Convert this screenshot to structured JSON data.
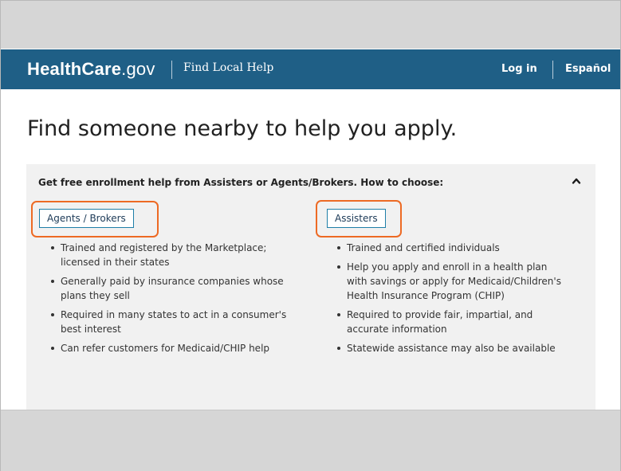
{
  "header": {
    "logo_main": "HealthCare",
    "logo_suffix": ".gov",
    "section": "Find Local Help",
    "login": "Log in",
    "language": "Español"
  },
  "page_title": "Find someone nearby to help you apply.",
  "panel": {
    "heading": "Get free enrollment help from Assisters or Agents/Brokers. How to choose:",
    "collapse_icon": "chevron-up-icon",
    "agents": {
      "label": "Agents / Brokers",
      "items": [
        "Trained and registered by the Marketplace; licensed in their states",
        "Generally paid by insurance companies whose plans they sell",
        "Required in many states to act in a consumer's best interest",
        "Can refer customers for Medicaid/CHIP help"
      ]
    },
    "assisters": {
      "label": "Assisters",
      "items": [
        "Trained and certified individuals",
        "Help you apply and enroll in a health plan with savings or apply for Medicaid/Children's Health Insurance Program (CHIP)",
        "Required to provide fair, impartial, and accurate information",
        "Statewide assistance may also be available"
      ]
    }
  },
  "colors": {
    "header_bg": "#1f5f86",
    "highlight": "#ed6a24",
    "tag_border": "#1f7fa8",
    "panel_bg": "#f1f1f1"
  }
}
